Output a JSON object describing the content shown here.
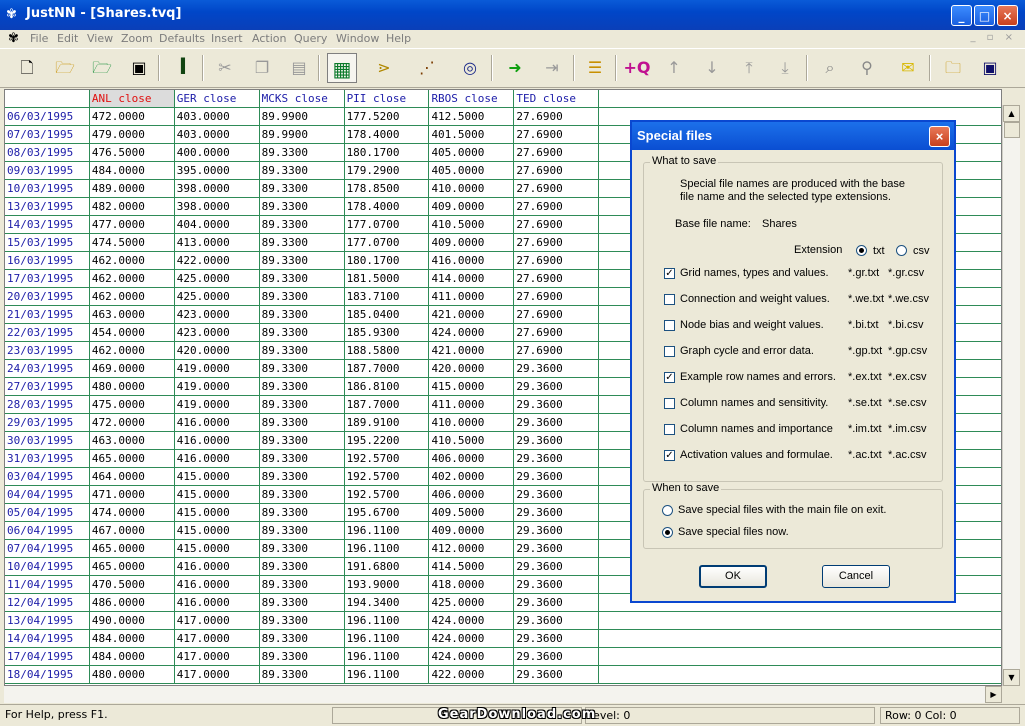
{
  "window": {
    "app_icon": "justnn-app-icon",
    "title": "JustNN - [Shares.tvq]",
    "buttons": [
      "_",
      "□",
      "×"
    ]
  },
  "menu": [
    "File",
    "Edit",
    "View",
    "Zoom",
    "Defaults",
    "Insert",
    "Action",
    "Query",
    "Window",
    "Help"
  ],
  "toolbar_icons": [
    "new-file-icon",
    "open-folder-icon",
    "open-folder-alt-icon",
    "save-disk-icon",
    "text-cursor-icon",
    "cut-icon",
    "copy-icon",
    "paste-icon",
    "grid-icon",
    "network-learn-icon",
    "network-view-icon",
    "compass-icon",
    "arrow-right-icon",
    "arrow-to-end-icon",
    "sort-lines-icon",
    "add-query-icon",
    "arrow-up-icon",
    "arrow-down-icon",
    "arrow-top-icon",
    "arrow-bottom-icon",
    "search-icon",
    "wrench-icon",
    "mail-icon",
    "folder-lock-icon",
    "save-disk-alt-icon"
  ],
  "grid": {
    "headers": [
      "",
      "ANL close",
      "GER close",
      "MCKS close",
      "PII close",
      "RBOS close",
      "TED close"
    ],
    "rows": [
      [
        "06/03/1995",
        "472.0000",
        "403.0000",
        "89.9900",
        "177.5200",
        "412.5000",
        "27.6900"
      ],
      [
        "07/03/1995",
        "479.0000",
        "403.0000",
        "89.9900",
        "178.4000",
        "401.5000",
        "27.6900"
      ],
      [
        "08/03/1995",
        "476.5000",
        "400.0000",
        "89.3300",
        "180.1700",
        "405.0000",
        "27.6900"
      ],
      [
        "09/03/1995",
        "484.0000",
        "395.0000",
        "89.3300",
        "179.2900",
        "405.0000",
        "27.6900"
      ],
      [
        "10/03/1995",
        "489.0000",
        "398.0000",
        "89.3300",
        "178.8500",
        "410.0000",
        "27.6900"
      ],
      [
        "13/03/1995",
        "482.0000",
        "398.0000",
        "89.3300",
        "178.4000",
        "409.0000",
        "27.6900"
      ],
      [
        "14/03/1995",
        "477.0000",
        "404.0000",
        "89.3300",
        "177.0700",
        "410.5000",
        "27.6900"
      ],
      [
        "15/03/1995",
        "474.5000",
        "413.0000",
        "89.3300",
        "177.0700",
        "409.0000",
        "27.6900"
      ],
      [
        "16/03/1995",
        "462.0000",
        "422.0000",
        "89.3300",
        "180.1700",
        "416.0000",
        "27.6900"
      ],
      [
        "17/03/1995",
        "462.0000",
        "425.0000",
        "89.3300",
        "181.5000",
        "414.0000",
        "27.6900"
      ],
      [
        "20/03/1995",
        "462.0000",
        "425.0000",
        "89.3300",
        "183.7100",
        "411.0000",
        "27.6900"
      ],
      [
        "21/03/1995",
        "463.0000",
        "423.0000",
        "89.3300",
        "185.0400",
        "421.0000",
        "27.6900"
      ],
      [
        "22/03/1995",
        "454.0000",
        "423.0000",
        "89.3300",
        "185.9300",
        "424.0000",
        "27.6900"
      ],
      [
        "23/03/1995",
        "462.0000",
        "420.0000",
        "89.3300",
        "188.5800",
        "421.0000",
        "27.6900"
      ],
      [
        "24/03/1995",
        "469.0000",
        "419.0000",
        "89.3300",
        "187.7000",
        "420.0000",
        "29.3600"
      ],
      [
        "27/03/1995",
        "480.0000",
        "419.0000",
        "89.3300",
        "186.8100",
        "415.0000",
        "29.3600"
      ],
      [
        "28/03/1995",
        "475.0000",
        "419.0000",
        "89.3300",
        "187.7000",
        "411.0000",
        "29.3600"
      ],
      [
        "29/03/1995",
        "472.0000",
        "416.0000",
        "89.3300",
        "189.9100",
        "410.0000",
        "29.3600"
      ],
      [
        "30/03/1995",
        "463.0000",
        "416.0000",
        "89.3300",
        "195.2200",
        "410.5000",
        "29.3600"
      ],
      [
        "31/03/1995",
        "465.0000",
        "416.0000",
        "89.3300",
        "192.5700",
        "406.0000",
        "29.3600"
      ],
      [
        "03/04/1995",
        "464.0000",
        "415.0000",
        "89.3300",
        "192.5700",
        "402.0000",
        "29.3600"
      ],
      [
        "04/04/1995",
        "471.0000",
        "415.0000",
        "89.3300",
        "192.5700",
        "406.0000",
        "29.3600"
      ],
      [
        "05/04/1995",
        "474.0000",
        "415.0000",
        "89.3300",
        "195.6700",
        "409.5000",
        "29.3600"
      ],
      [
        "06/04/1995",
        "467.0000",
        "415.0000",
        "89.3300",
        "196.1100",
        "409.0000",
        "29.3600"
      ],
      [
        "07/04/1995",
        "465.0000",
        "415.0000",
        "89.3300",
        "196.1100",
        "412.0000",
        "29.3600"
      ],
      [
        "10/04/1995",
        "465.0000",
        "416.0000",
        "89.3300",
        "191.6800",
        "414.5000",
        "29.3600"
      ],
      [
        "11/04/1995",
        "470.5000",
        "416.0000",
        "89.3300",
        "193.9000",
        "418.0000",
        "29.3600"
      ],
      [
        "12/04/1995",
        "486.0000",
        "416.0000",
        "89.3300",
        "194.3400",
        "425.0000",
        "29.3600"
      ],
      [
        "13/04/1995",
        "490.0000",
        "417.0000",
        "89.3300",
        "196.1100",
        "424.0000",
        "29.3600"
      ],
      [
        "14/04/1995",
        "484.0000",
        "417.0000",
        "89.3300",
        "196.1100",
        "424.0000",
        "29.3600"
      ],
      [
        "17/04/1995",
        "484.0000",
        "417.0000",
        "89.3300",
        "196.1100",
        "424.0000",
        "29.3600"
      ],
      [
        "18/04/1995",
        "480.0000",
        "417.0000",
        "89.3300",
        "196.1100",
        "422.0000",
        "29.3600"
      ]
    ]
  },
  "status": {
    "help": "For Help, press F1.",
    "level": "level: 0",
    "position": "Row: 0  Col: 0"
  },
  "watermark": "GearDownload.com",
  "dialog": {
    "title": "Special files",
    "close": "×",
    "what_legend": "What to save",
    "desc_line1": "Special file names are produced with the base",
    "desc_line2": "file name and the selected type extensions.",
    "base_label": "Base file name:",
    "base_value": "Shares",
    "ext_label": "Extension",
    "ext_txt": "txt",
    "ext_csv": "csv",
    "ext_selected": "txt",
    "options": [
      {
        "label": "Grid names, types and values.",
        "checked": true,
        "txt": "*.gr.txt",
        "csv": "*.gr.csv"
      },
      {
        "label": "Connection and weight values.",
        "checked": false,
        "txt": "*.we.txt",
        "csv": "*.we.csv"
      },
      {
        "label": "Node bias and weight values.",
        "checked": false,
        "txt": "*.bi.txt",
        "csv": "*.bi.csv"
      },
      {
        "label": "Graph cycle and error data.",
        "checked": false,
        "txt": "*.gp.txt",
        "csv": "*.gp.csv"
      },
      {
        "label": "Example row names and errors.",
        "checked": true,
        "txt": "*.ex.txt",
        "csv": "*.ex.csv"
      },
      {
        "label": "Column names and sensitivity.",
        "checked": false,
        "txt": "*.se.txt",
        "csv": "*.se.csv"
      },
      {
        "label": "Column names and importance",
        "checked": false,
        "txt": "*.im.txt",
        "csv": "*.im.csv"
      },
      {
        "label": "Activation values and formulae.",
        "checked": true,
        "txt": "*.ac.txt",
        "csv": "*.ac.csv"
      }
    ],
    "when_legend": "When to save",
    "when_exit": "Save special files with the main file on exit.",
    "when_now": "Save special files now.",
    "when_selected": "now",
    "ok": "OK",
    "cancel": "Cancel"
  }
}
